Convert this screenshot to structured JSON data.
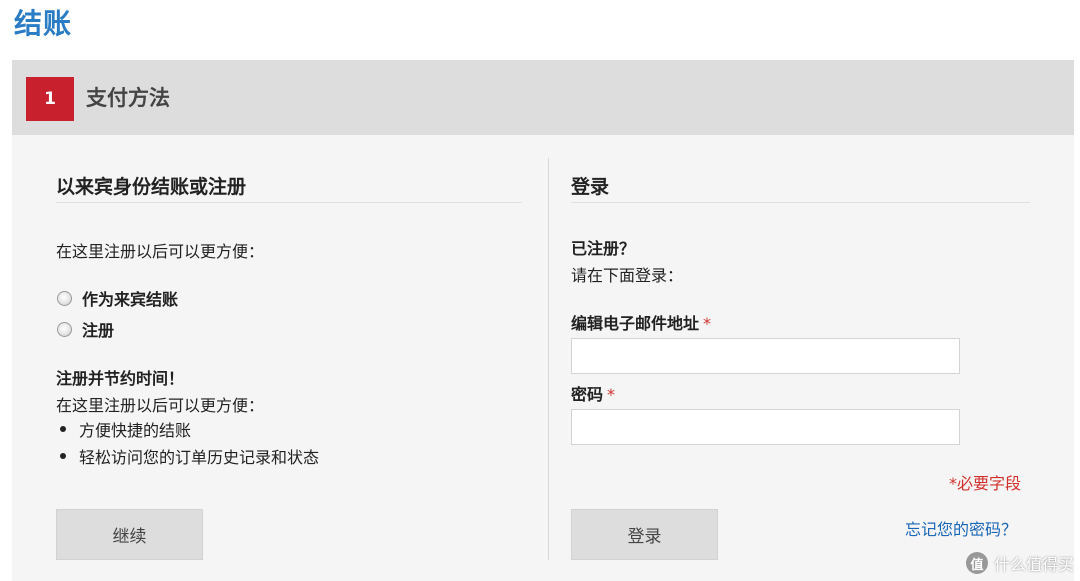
{
  "page_title": "结账",
  "step": {
    "number": "1",
    "title": "支付方法"
  },
  "guest": {
    "title": "以来宾身份结账或注册",
    "intro": "在这里注册以后可以更方便：",
    "options": [
      {
        "label": "作为来宾结账",
        "checked": false
      },
      {
        "label": "注册",
        "checked": false
      }
    ],
    "save_time_heading": "注册并节约时间！",
    "save_time_text": "在这里注册以后可以更方便：",
    "benefits": [
      "方便快捷的结账",
      "轻松访问您的订单历史记录和状态"
    ],
    "continue_label": "继续"
  },
  "login": {
    "title": "登录",
    "registered_heading": "已注册？",
    "registered_text": "请在下面登录：",
    "email_label": "编辑电子邮件地址",
    "email_value": "",
    "password_label": "密码",
    "password_value": "",
    "required_marker": "*",
    "required_note": "*必要字段",
    "login_label": "登录",
    "forgot_label": "忘记您的密码？"
  },
  "watermark": {
    "logo": "值",
    "text": "什么值得买"
  },
  "colors": {
    "title": "#2a7cc4",
    "step_badge": "#c8202d",
    "required": "#d1312d",
    "link": "#1a67b8"
  }
}
